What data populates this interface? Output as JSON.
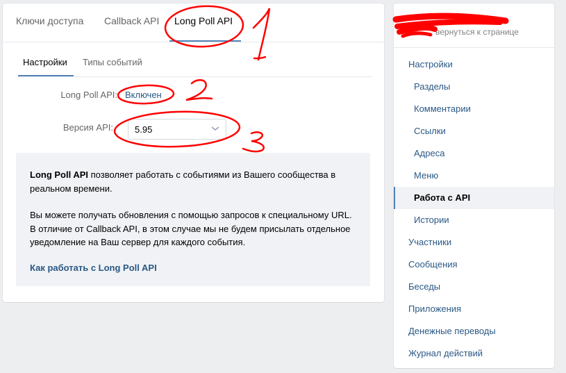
{
  "top_tabs": [
    {
      "label": "Ключи доступа",
      "active": false
    },
    {
      "label": "Callback API",
      "active": false
    },
    {
      "label": "Long Poll API",
      "active": true
    }
  ],
  "sub_tabs": [
    {
      "label": "Настройки",
      "active": true
    },
    {
      "label": "Типы событий",
      "active": false
    }
  ],
  "settings": {
    "status_label": "Long Poll API:",
    "status_value": "Включен",
    "version_label": "Версия API:",
    "version_value": "5.95"
  },
  "info": {
    "p1_bold": "Long Poll API",
    "p1_rest": " позволяет работать с событиями из Вашего сообщества в реальном времени.",
    "p2": "Вы можете получать обновления с помощью запросов к специальному URL. В отличие от Callback API, в этом случае мы не будем присылать отдельное уведомление на Ваш сервер для каждого события.",
    "link": "Как работать с Long Poll API"
  },
  "sidebar": {
    "back_link": "вернуться к странице",
    "items": [
      {
        "label": "Настройки",
        "level": 0
      },
      {
        "label": "Разделы",
        "level": 1
      },
      {
        "label": "Комментарии",
        "level": 1
      },
      {
        "label": "Ссылки",
        "level": 1
      },
      {
        "label": "Адреса",
        "level": 1
      },
      {
        "label": "Меню",
        "level": 1
      },
      {
        "label": "Работа с API",
        "level": 1,
        "active": true
      },
      {
        "label": "Истории",
        "level": 1
      },
      {
        "label": "Участники",
        "level": 0
      },
      {
        "label": "Сообщения",
        "level": 0
      },
      {
        "label": "Беседы",
        "level": 0
      },
      {
        "label": "Приложения",
        "level": 0
      },
      {
        "label": "Денежные переводы",
        "level": 0
      },
      {
        "label": "Журнал действий",
        "level": 0
      }
    ]
  },
  "colors": {
    "accent": "#5181b8",
    "link": "#2a5885",
    "annotation": "#ff0000",
    "background": "#edeef0"
  }
}
